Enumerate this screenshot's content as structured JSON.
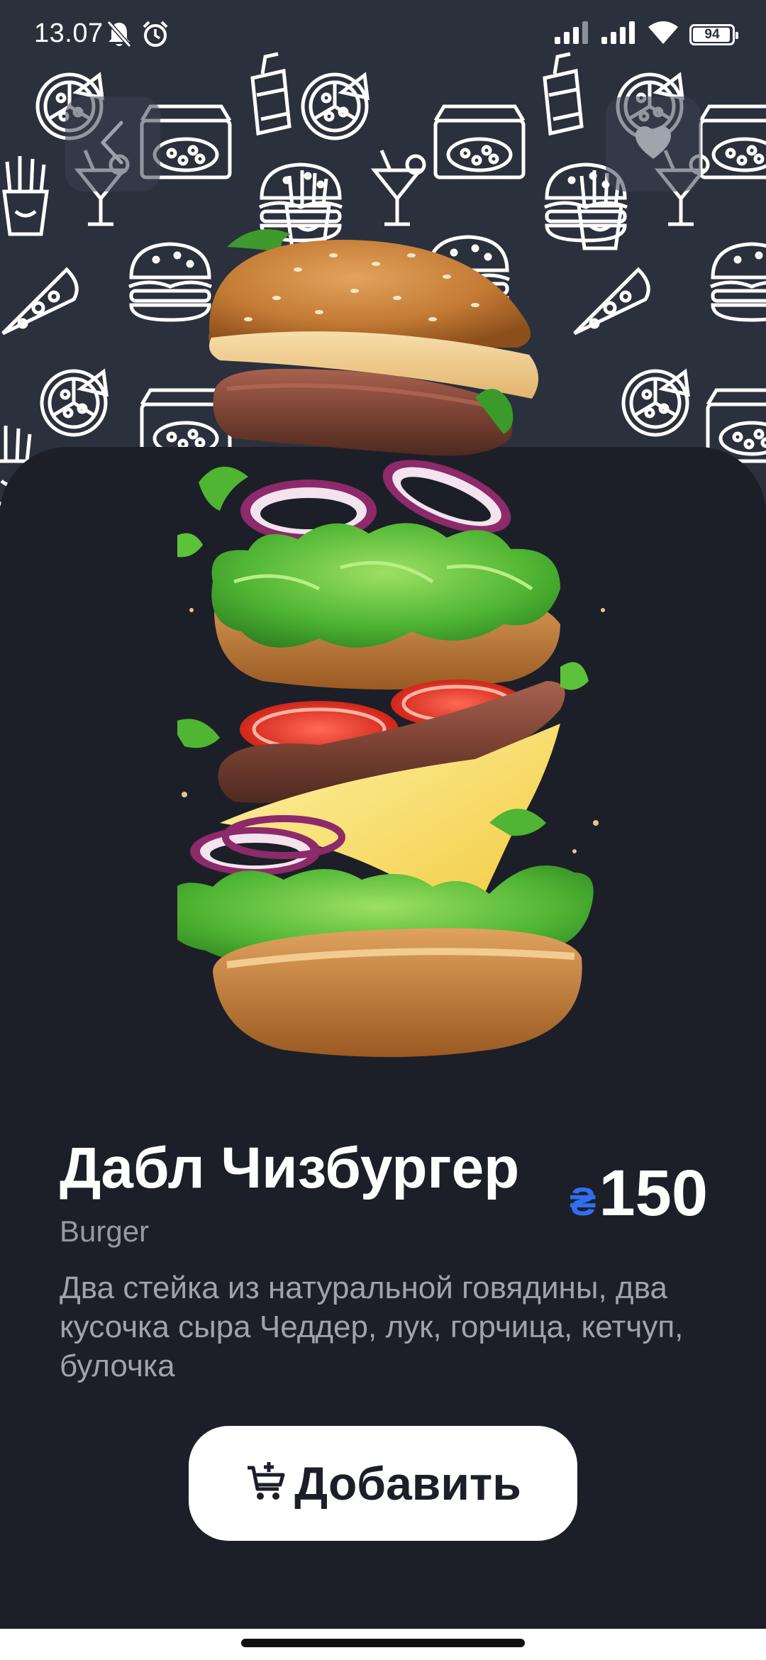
{
  "status_bar": {
    "time": "13.07",
    "battery_level": "94",
    "icons": [
      "bell-off-icon",
      "alarm-icon",
      "signal-icon",
      "signal-icon",
      "wifi-icon",
      "battery-icon"
    ]
  },
  "header": {
    "back_icon": "chevron-left-icon",
    "favorite_icon": "heart-icon"
  },
  "product": {
    "title": "Дабл Чизбургер",
    "category": "Burger",
    "description": "Два стейка из натуральной говядины, два кусочка сыра Чеддер, лук, горчица, кетчуп, булочка",
    "price_currency": "₴",
    "price_value": "150"
  },
  "add_button": {
    "label": "Добавить",
    "icon": "cart-add-icon"
  },
  "colors": {
    "background": "#1c1f28",
    "pattern_background": "#2b303d",
    "accent_currency": "#2f6ff0",
    "button_background": "#ffffff"
  }
}
